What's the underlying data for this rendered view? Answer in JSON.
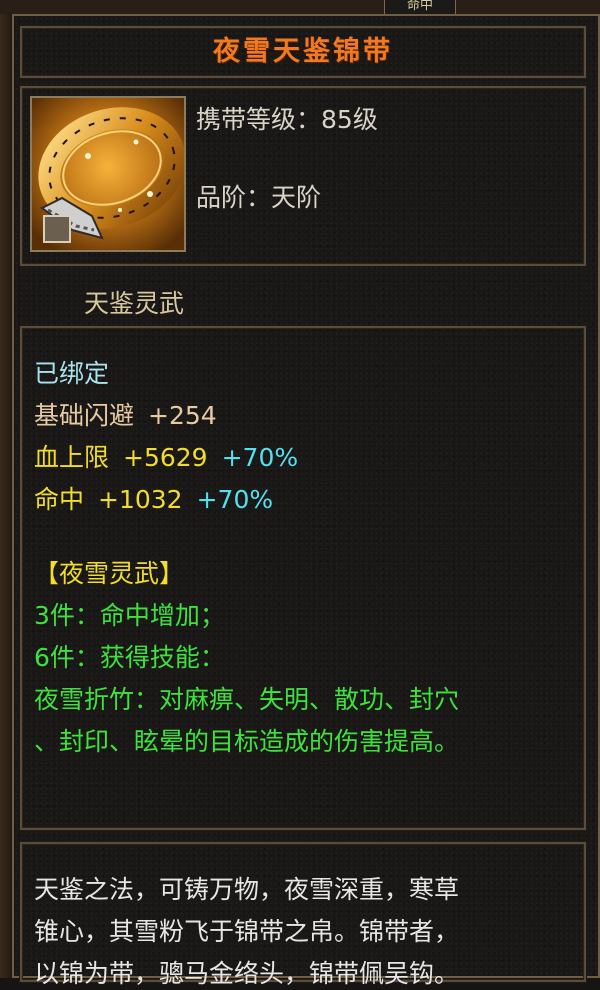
{
  "header_tab": "命中",
  "item": {
    "name": "夜雪天鉴锦带",
    "icon": "ornate-belt-icon",
    "level_label": "携带等级：",
    "level_value": "85级",
    "grade_label": "品阶：",
    "grade_value": "天阶",
    "quality_name": "天鉴灵武"
  },
  "attributes": {
    "bound": "已绑定",
    "stats": [
      {
        "name": "基础闪避",
        "value": "+254",
        "percent": ""
      },
      {
        "name": "血上限",
        "value": "+5629",
        "percent": "+70%"
      },
      {
        "name": "命中",
        "value": "+1032",
        "percent": "+70%"
      }
    ]
  },
  "set_bonus": {
    "title": "【夜雪灵武】",
    "lines": [
      "3件：命中增加；",
      "6件：获得技能："
    ],
    "skill_line_1": "夜雪折竹：对麻痹、失明、散功、封穴",
    "skill_line_2": "、封印、眩晕的目标造成的伤害提高。"
  },
  "description": {
    "lines": [
      "天鉴之法，可铸万物，夜雪深重，寒草",
      "锥心，其雪粉飞于锦带之帛。锦带者，",
      "以锦为带，骢马金络头，锦带佩吴钩。"
    ]
  },
  "colors": {
    "title": "#ee7a22",
    "bound": "#a9e3ee",
    "base_stat": "#e6cba2",
    "percent_bonus": "#55e0ef",
    "set_title": "#f2dc2c",
    "set_text": "#3fe23c",
    "border": "#6e5e44"
  }
}
